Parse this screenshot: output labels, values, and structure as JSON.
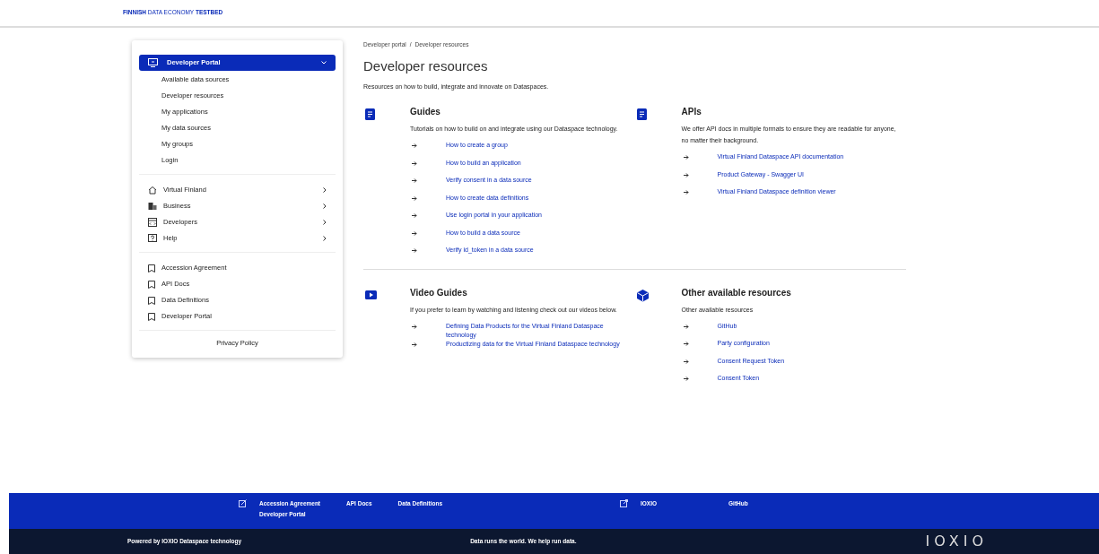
{
  "header": {
    "brand": "**FINNISH** DATA ECONOMY **TESTBED**"
  },
  "sidebar": {
    "menu": {
      "label": "Developer Portal",
      "expanded": true,
      "selected": true,
      "children": [
        {
          "label": "Available data sources"
        },
        {
          "label": "Developer resources"
        },
        {
          "label": "My applications"
        },
        {
          "label": "My data sources"
        },
        {
          "label": "My groups"
        },
        {
          "label": "Login"
        }
      ]
    },
    "categories": [
      {
        "label": "Virtual Finland",
        "kind": "house"
      },
      {
        "label": "Business",
        "kind": "building"
      },
      {
        "label": "Developers",
        "kind": "code"
      },
      {
        "label": "Help",
        "kind": "help"
      }
    ],
    "links": [
      "Accession Agreement",
      "API Docs",
      "Data Definitions",
      "Developer Portal"
    ],
    "privacy": "Privacy Policy"
  },
  "breadcrumb": [
    "Developer portal",
    "/",
    "Developer resources"
  ],
  "page_title": "Developer resources",
  "intro": "Resources on how to build, integrate and innovate on Dataspaces.",
  "sections": [
    {
      "kind": "document",
      "title": "Guides",
      "description": "Tutorials on how to build on and integrate using our Dataspace technology.",
      "links": [
        "How to create a group",
        "How to build an application",
        "Verify consent in a data source",
        "How to create data definitions",
        "Use login portal in your application",
        "How to build a data source",
        "Verify id_token in a data source"
      ]
    },
    {
      "kind": "document",
      "title": "APIs",
      "description": "We offer API docs in multiple formats to ensure they are readable for anyone, no matter their background.",
      "links": [
        "Virtual Finland Dataspace API documentation",
        "Product Gateway - Swagger UI",
        "Virtual Finland Dataspace definition viewer"
      ]
    },
    {
      "kind": "video",
      "title": "Video Guides",
      "description": "If you prefer to learn by watching and listening check out our videos below.",
      "links": [
        "Defining Data Products for the Virtual Finland Dataspace technology",
        "Productizing data for the Virtual Finland Dataspace technology"
      ]
    },
    {
      "kind": "cube",
      "title": "Other available resources",
      "description": "Other available resources",
      "links": [
        "GitHub",
        "Party configuration",
        "Consent Request Token",
        "Consent Token"
      ]
    }
  ],
  "footer": {
    "groups": [
      {
        "kind": "edit",
        "links": [
          "Accession Agreement",
          "API Docs",
          "Data Definitions",
          "Developer Portal"
        ]
      },
      {
        "kind": "external",
        "links": [
          "IOXIO",
          "GitHub"
        ]
      }
    ],
    "powered": "Powered by IOXIO Dataspace technology",
    "slogan": "Data runs the world. We help run data.",
    "logo": "IOXIO"
  }
}
